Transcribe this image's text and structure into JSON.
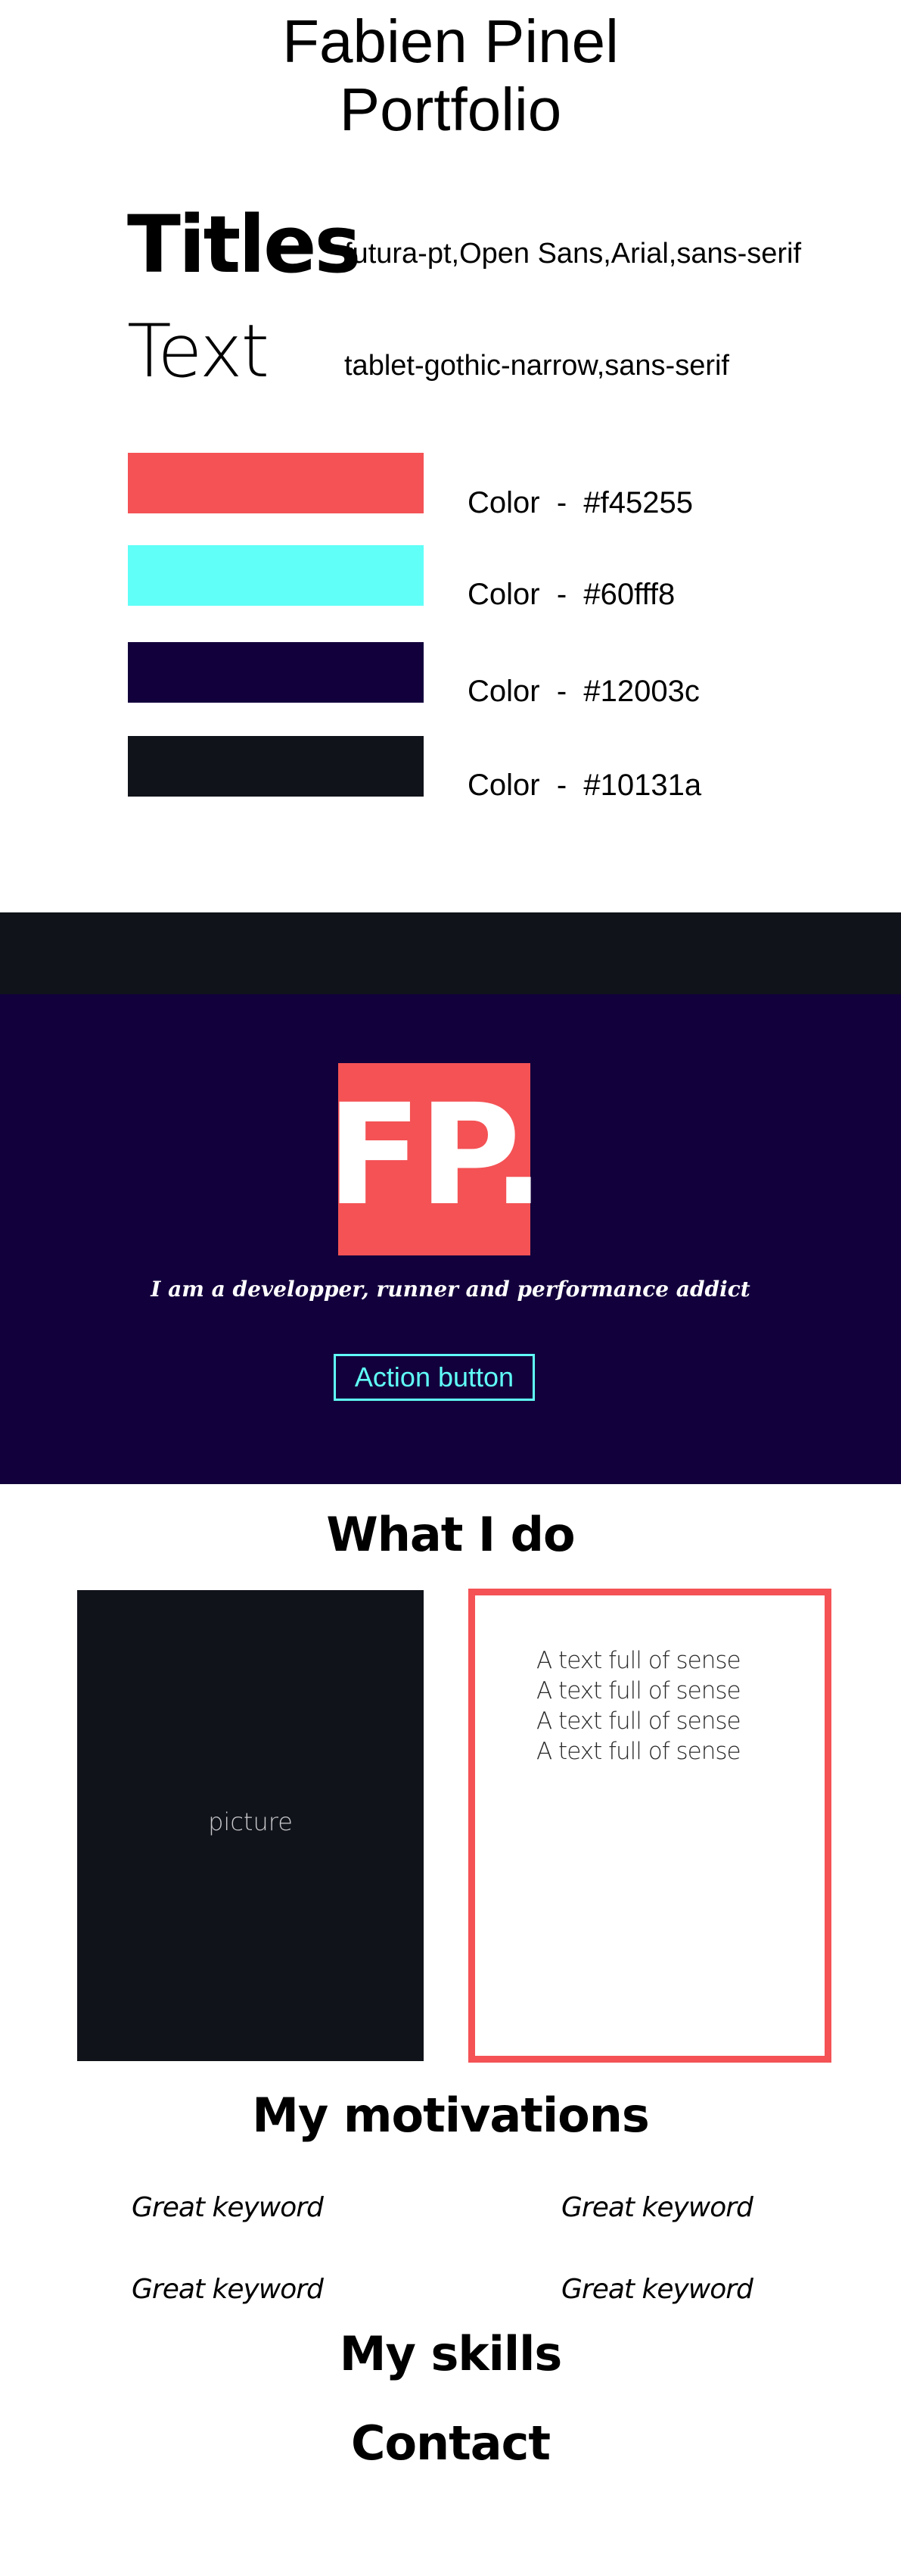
{
  "header": {
    "title_line1": "Fabien Pinel",
    "title_line2": "Portfolio"
  },
  "typography": {
    "titles_sample": "Titles",
    "titles_font": "futura-pt,Open Sans,Arial,sans-serif",
    "text_sample": "Text",
    "text_font": "tablet-gothic-narrow,sans-serif"
  },
  "palette": [
    {
      "label": "Color  -  #f45255",
      "hex": "#f45255"
    },
    {
      "label": "Color  -  #60fff8",
      "hex": "#60fff8"
    },
    {
      "label": "Color  -  #12003c",
      "hex": "#12003c"
    },
    {
      "label": "Color  -  #10131a",
      "hex": "#10131a"
    }
  ],
  "hero": {
    "logo_text": "FP.",
    "tagline": "I am a developper, runner and performance addict",
    "action_button": "Action button"
  },
  "what_i_do": {
    "title": "What I do",
    "picture_label": "picture",
    "text_lines": [
      "A text full of sense",
      "A text full of sense",
      "A text full of sense",
      "A text full of sense"
    ]
  },
  "motivations": {
    "title": "My motivations",
    "keywords": [
      "Great keyword",
      "Great keyword",
      "Great keyword",
      "Great keyword"
    ]
  },
  "skills": {
    "title": "My skills"
  },
  "contact": {
    "title": "Contact"
  }
}
